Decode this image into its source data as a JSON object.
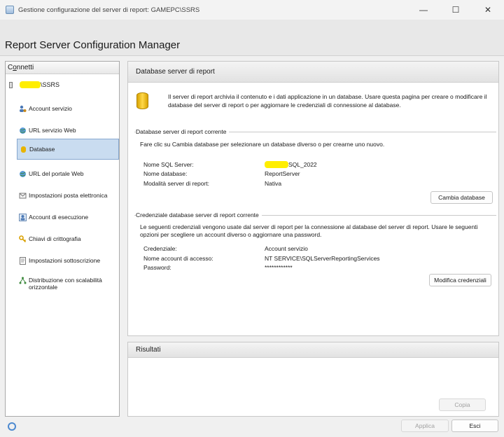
{
  "window": {
    "title": "Gestione configurazione del server di report: GAMEPC\\SSRS",
    "minimize": "—",
    "maximize": "☐",
    "close": "✕"
  },
  "header": {
    "app_title": "Report Server Configuration Manager"
  },
  "sidebar": {
    "connect_prefix": "C",
    "connect_underline": "o",
    "connect_rest": "nnetti",
    "server_suffix": "\\SSRS",
    "items": [
      {
        "label": "Account servizio",
        "icon": "user-gear-icon"
      },
      {
        "label": "URL servizio Web",
        "icon": "globe-icon"
      },
      {
        "label": "Database",
        "icon": "database-icon"
      },
      {
        "label": "URL del portale Web",
        "icon": "globe-icon"
      },
      {
        "label": "Impostazioni posta elettronica",
        "icon": "mail-icon"
      },
      {
        "label": "Account di esecuzione",
        "icon": "user-icon"
      },
      {
        "label": "Chiavi di crittografia",
        "icon": "key-icon"
      },
      {
        "label": "Impostazioni sottoscrizione",
        "icon": "document-icon"
      },
      {
        "label": "Distribuzione con scalabilità orizzontale",
        "icon": "network-icon"
      }
    ],
    "selected_index": 2
  },
  "main": {
    "heading": "Database server di report",
    "intro": "Il server di report archivia il contenuto e i dati applicazione in un database. Usare questa pagina per creare o modificare il database del server di report o per aggiornare le credenziali di connessione al database.",
    "current_db": {
      "title": "Database server di report corrente",
      "text": "Fare clic su Cambia database per selezionare un database diverso o per crearne uno nuovo.",
      "sql_server_label": "Nome SQL Server:",
      "sql_server_value_suffix": "SQL_2022",
      "db_name_label": "Nome database:",
      "db_name_value": "ReportServer",
      "mode_label": "Modalità server di report:",
      "mode_value": "Nativa",
      "button": "Cambia database"
    },
    "credentials": {
      "title": "Credenziale database server di report corrente",
      "text": "Le seguenti credenziali vengono usate dal server di report per la connessione al database del server di report. Usare le seguenti opzioni per scegliere un account diverso o aggiornare una password.",
      "cred_label": "Credenziale:",
      "cred_value": "Account servizio",
      "login_label": "Nome account di accesso:",
      "login_value": "NT SERVICE\\SQLServerReportingServices",
      "password_label": "Password:",
      "password_value": "************",
      "button": "Modifica credenziali"
    }
  },
  "results": {
    "heading": "Risultati",
    "copy_button": "Copia"
  },
  "footer": {
    "apply_button": "Applica",
    "exit_button": "Esci"
  }
}
